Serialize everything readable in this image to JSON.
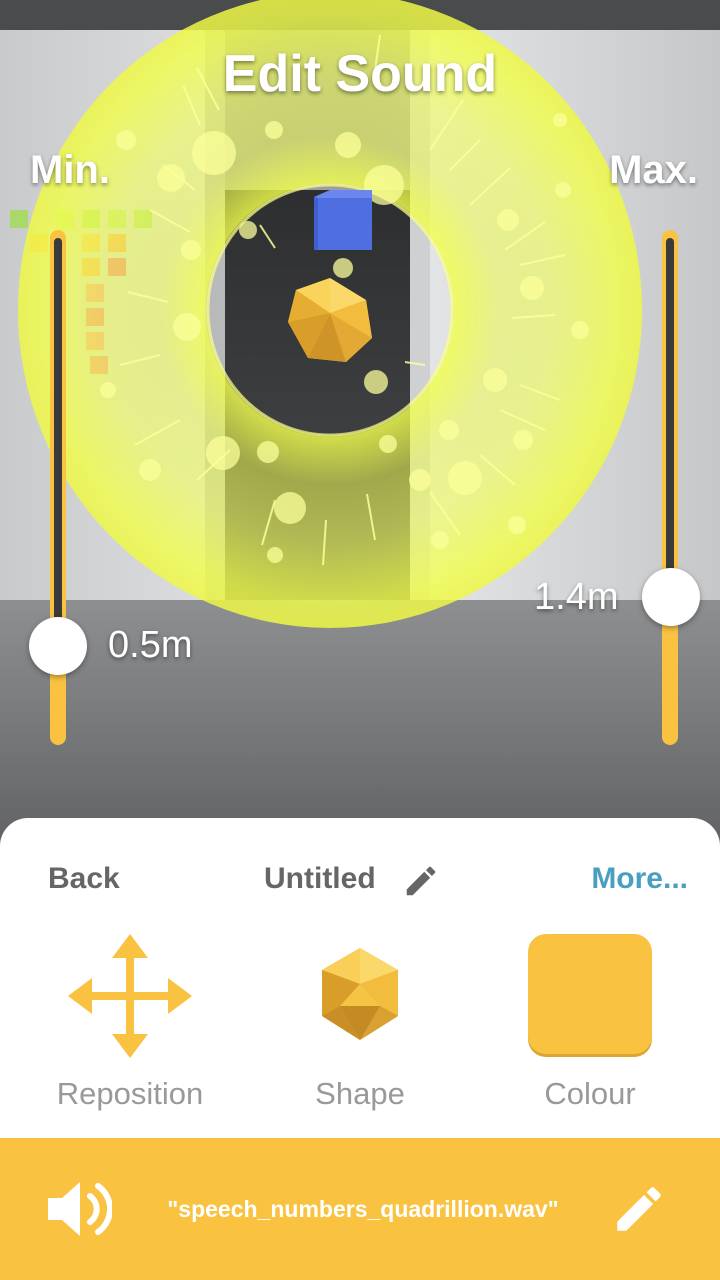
{
  "header": {
    "title": "Edit Sound"
  },
  "range": {
    "min_label": "Min.",
    "max_label": "Max.",
    "min_value": "0.5m",
    "max_value": "1.4m"
  },
  "sheet": {
    "back_label": "Back",
    "sound_name": "Untitled",
    "more_label": "More...",
    "tools": {
      "reposition": "Reposition",
      "shape": "Shape",
      "colour": "Colour"
    }
  },
  "footer": {
    "file_name": "\"speech_numbers_quadrillion.wav\""
  },
  "colors": {
    "accent": "#f9c240",
    "link": "#4a9fc1",
    "cube": "#4f6fe0"
  },
  "icons": {
    "name_edit": "pencil-icon",
    "reposition": "move-arrows-icon",
    "shape": "icosahedron-icon",
    "speaker": "speaker-icon",
    "file_edit": "pencil-icon"
  }
}
